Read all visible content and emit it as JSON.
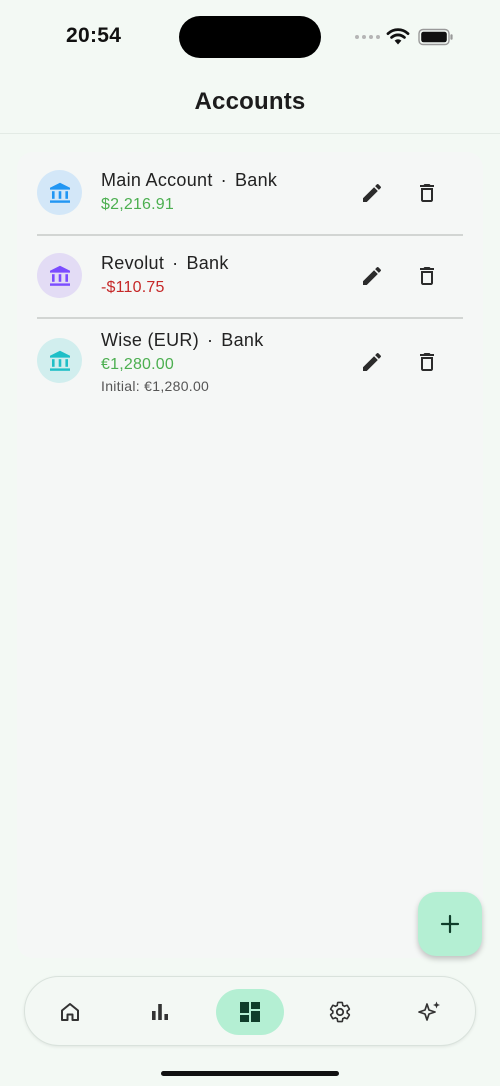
{
  "status_bar": {
    "time": "20:54"
  },
  "app_bar": {
    "title": "Accounts"
  },
  "accounts": [
    {
      "name": "Main Account",
      "separator": "·",
      "type": "Bank",
      "balance": "$2,216.91",
      "balance_color": "#4caf50",
      "icon_color": "#2196f3",
      "icon_bg": "#d3e7f8"
    },
    {
      "name": "Revolut",
      "separator": "·",
      "type": "Bank",
      "balance": "-$110.75",
      "balance_color": "#c62828",
      "icon_color": "#7c4dff",
      "icon_bg": "#e3dcf5"
    },
    {
      "name": "Wise (EUR)",
      "separator": "·",
      "type": "Bank",
      "balance": "€1,280.00",
      "balance_color": "#4caf50",
      "initial": "Initial: €1,280.00",
      "icon_color": "#1fbfc7",
      "icon_bg": "#d1eeee"
    }
  ],
  "icons": {
    "account": "bank-icon",
    "edit": "pencil-icon",
    "delete": "trash-icon",
    "fab": "plus-icon",
    "nav": [
      "home-icon",
      "bar-chart-icon",
      "dashboard-icon",
      "gear-icon",
      "sparkles-icon"
    ]
  },
  "colors": {
    "background": "#f3f9f4",
    "accent": "#b4efd3",
    "positive": "#4caf50",
    "negative": "#c62828"
  },
  "bottom_nav": {
    "active_index": 2
  }
}
